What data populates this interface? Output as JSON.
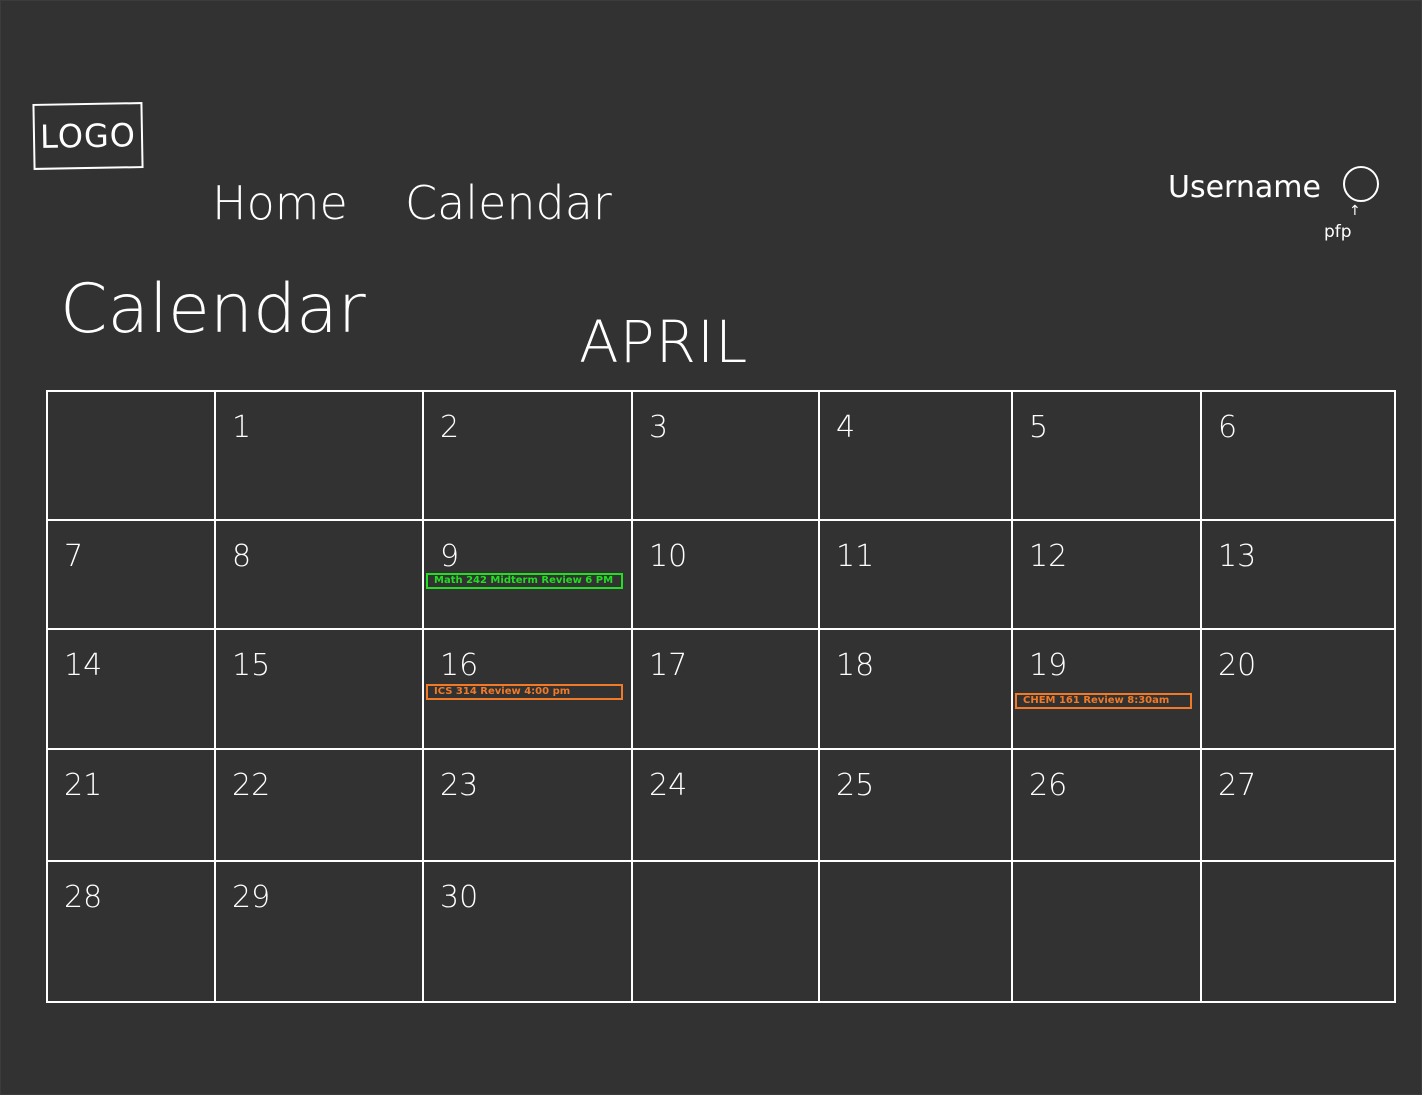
{
  "header": {
    "logo_text": "LOGO",
    "nav": [
      {
        "label": "Home"
      },
      {
        "label": "Calendar"
      }
    ],
    "username": "Username",
    "pfp_arrow": "↑",
    "pfp_label": "pfp"
  },
  "page_title": "Calendar",
  "month": "APRIL",
  "weeks": [
    [
      "",
      "1",
      "2",
      "3",
      "4",
      "5",
      "6"
    ],
    [
      "7",
      "8",
      "9",
      "10",
      "11",
      "12",
      "13"
    ],
    [
      "14",
      "15",
      "16",
      "17",
      "18",
      "19",
      "20"
    ],
    [
      "21",
      "22",
      "23",
      "24",
      "25",
      "26",
      "27"
    ],
    [
      "28",
      "29",
      "30",
      "",
      "",
      "",
      ""
    ]
  ],
  "events": [
    {
      "week": 1,
      "day": 2,
      "label": "Math 242 Midterm Review 6 PM",
      "color": "#22dd22"
    },
    {
      "week": 2,
      "day": 2,
      "label": "ICS 314 Review 4:00 pm",
      "color": "#f07a28"
    },
    {
      "week": 2,
      "day": 5,
      "label": "CHEM 161 Review 8:30am",
      "color": "#f07a28"
    }
  ],
  "colors": {
    "background": "#323232",
    "line": "#ffffff",
    "event_green": "#22dd22",
    "event_orange": "#f07a28"
  }
}
